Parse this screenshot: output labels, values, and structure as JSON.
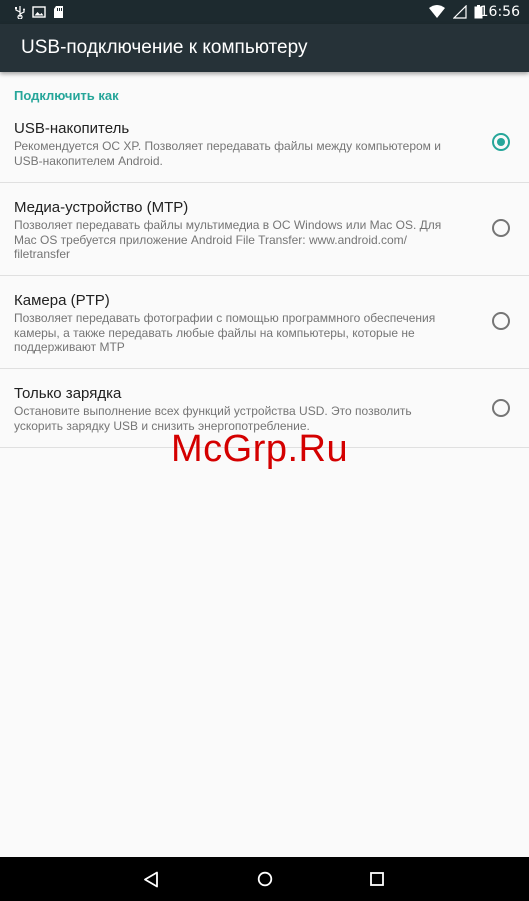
{
  "status_bar": {
    "time": "16:56",
    "left_icons": [
      "usb-icon",
      "image-icon",
      "sd-card-icon"
    ],
    "right_icons": [
      "wifi-icon",
      "signal-icon",
      "battery-icon"
    ]
  },
  "app_bar": {
    "title": "USB-подключение к компьютеру"
  },
  "section": {
    "header": "Подключить как"
  },
  "options": [
    {
      "title": "USB-накопитель",
      "description": "Рекомендуется ОС XP. Позволяет передавать файлы между компьютером и USB-накопителем Android.",
      "selected": true
    },
    {
      "title": "Медиа-устройство (MTP)",
      "description": "Позволяет передавать файлы мультимедиа в ОС Windows или Mac OS. Для Mac OS требуется приложение Android File Transfer: www.android.com/ filetransfer",
      "selected": false
    },
    {
      "title": "Камера (PTP)",
      "description": "Позволяет передавать фотографии с помощью программного обеспечения камеры, а также передавать любые файлы на компьютеры, которые не поддерживают MTP",
      "selected": false
    },
    {
      "title": "Только зарядка",
      "description": "Остановите выполнение всех функций устройства USD. Это позволить ускорить зарядку USB и снизить энергопотребление.",
      "selected": false
    }
  ],
  "watermark": "McGrp.Ru",
  "nav_bar": {
    "icons": [
      "back-icon",
      "home-icon",
      "recents-icon"
    ]
  },
  "colors": {
    "accent": "#26a69a",
    "app_bar": "#263238",
    "status_bar": "#1d2a2f"
  }
}
